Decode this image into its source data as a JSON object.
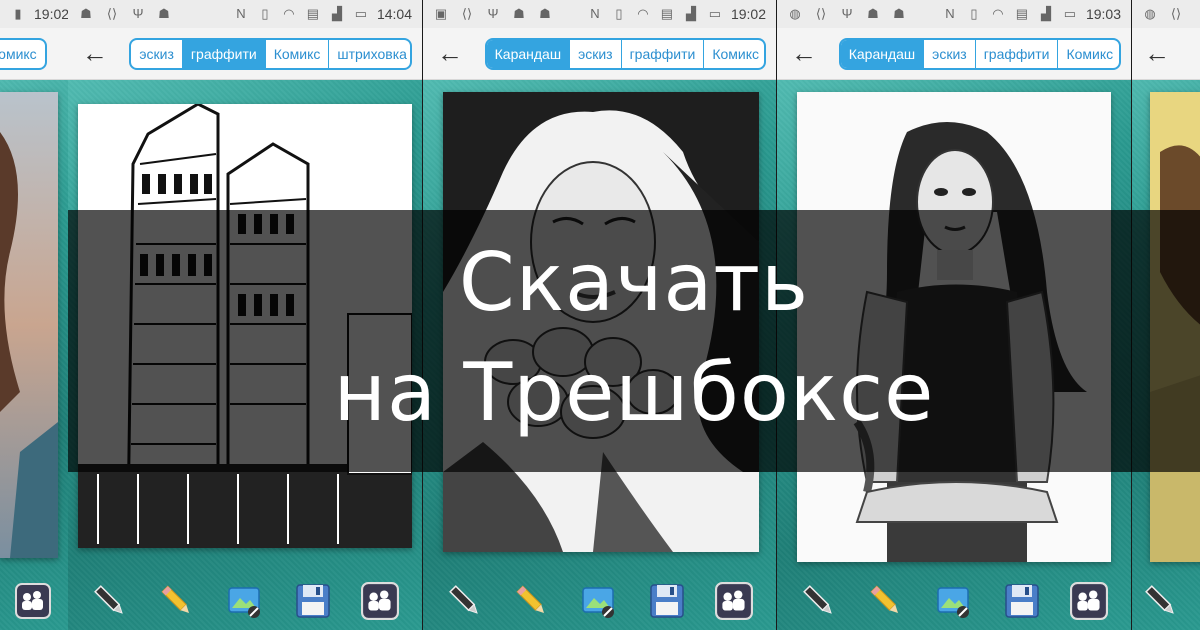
{
  "phones": [
    {
      "time": "19:02",
      "tabs": [
        "Комикс"
      ],
      "active": -1
    },
    {
      "time": "14:04",
      "tabs": [
        "эскиз",
        "граффити",
        "Комикс",
        "штриховка"
      ],
      "active": 1
    },
    {
      "time": "19:02",
      "tabs": [
        "Карандаш",
        "эскиз",
        "граффити",
        "Комикс"
      ],
      "active": 0
    },
    {
      "time": "19:03",
      "tabs": [
        "Карандаш",
        "эскиз",
        "граффити",
        "Комикс"
      ],
      "active": 0
    }
  ],
  "banner": {
    "line1": "Скачать",
    "line2": "на Трешбоксе"
  },
  "icons": {
    "back": "arrow-left-icon",
    "tools": [
      "pencil-black-icon",
      "pencil-yellow-icon",
      "gallery-magic-icon",
      "save-floppy-icon",
      "group-share-icon"
    ]
  },
  "colors": {
    "accent": "#34a4e0",
    "teal": "#2a9a90",
    "statusbar": "#ececec"
  }
}
